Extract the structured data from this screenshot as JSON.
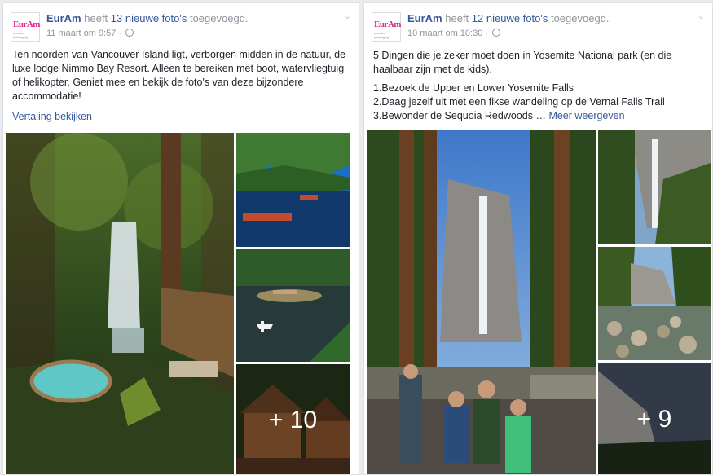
{
  "post1": {
    "page_name": "EurAm",
    "logo_text": "EurAm",
    "logo_sub": "creative packaging",
    "action_pre": "heeft",
    "count_text": "13 nieuwe foto's",
    "action_post": "toegevoegd.",
    "timestamp": "11 maart om 9:57 ·",
    "body": "Ten noorden van Vancouver Island ligt, verborgen midden in de natuur, de luxe lodge Nimmo Bay Resort. Alleen te bereiken met boot, watervliegtuig of helikopter. Geniet mee en bekijk de foto's van deze bijzondere accommodatie!",
    "translate_link": "Vertaling bekijken",
    "more_photos": "+ 10"
  },
  "post2": {
    "page_name": "EurAm",
    "logo_text": "EurAm",
    "logo_sub": "creative packaging",
    "action_pre": "heeft",
    "count_text": "12 nieuwe foto's",
    "action_post": "toegevoegd.",
    "timestamp": "10 maart om 10:30 ·",
    "body_intro": "5 Dingen die je zeker moet doen in Yosemite National park (en die haalbaar zijn met de kids).",
    "list": [
      "1.Bezoek de Upper en Lower Yosemite Falls",
      "2.Daag jezelf uit met een fikse wandeling op de Vernal Falls Trail",
      "3.Bewonder de Sequoia Redwoods …"
    ],
    "see_more": "Meer weergeven",
    "more_photos": "+ 9"
  }
}
